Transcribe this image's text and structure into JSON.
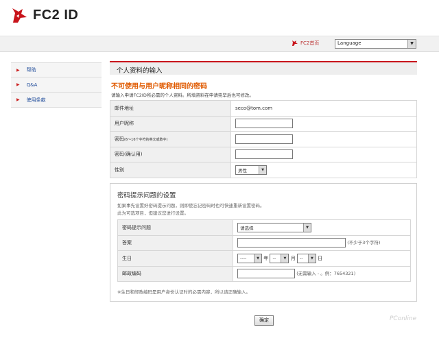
{
  "header": {
    "logo_text": "FC2 ID",
    "home_link": "FC2首页",
    "language_select": "Language"
  },
  "sidebar": {
    "items": [
      {
        "label": "帮助"
      },
      {
        "label": "Q&A"
      },
      {
        "label": "使用条款"
      }
    ]
  },
  "main": {
    "section_title": "个人资料的输入",
    "warning": "不可使用与用户昵称相同的密码",
    "note": "请输入申请FC2ID所必需的个人资料。所填资料在申请完毕后也可修改。",
    "rows": [
      {
        "label": "邮件地址",
        "value": "seco@tom.com"
      },
      {
        "label": "用户昵称"
      },
      {
        "label": "密码",
        "label_small": "(6～16个字符的英文或数字)"
      },
      {
        "label": "密码(确认用)"
      },
      {
        "label": "性别",
        "select": "男性"
      }
    ]
  },
  "hint": {
    "title": "密码提示问题的设置",
    "desc_line1": "如果事先设置好密码提示问题，则即使忘记密码时也可快速重新设置密码。",
    "desc_line2": "此为可选项目，但建议您进行设置。",
    "rows": {
      "question_label": "密码提示问题",
      "question_select": "请选择",
      "answer_label": "答案",
      "answer_note": "(不少于3个字符)",
      "birthday_label": "生日",
      "year_select": "----",
      "year_unit": "年",
      "month_select": "--",
      "month_unit": "月",
      "day_select": "--",
      "day_unit": "日",
      "postal_label": "邮政编码",
      "postal_note": "(无需输入 - 。例：7654321)"
    },
    "footnote": "※生日和邮政编码是用户身份认证时的必需内容，所以请正确输入。"
  },
  "submit_label": "确定",
  "watermark": "PConline"
}
